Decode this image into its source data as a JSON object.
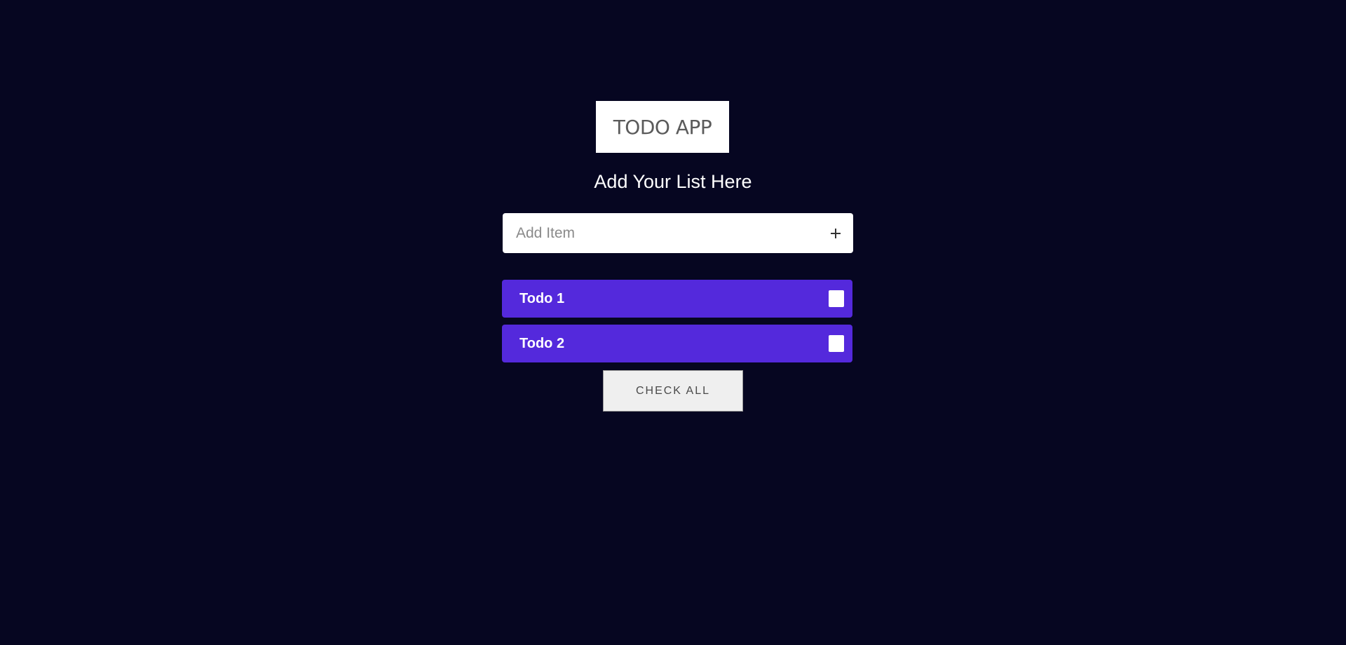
{
  "header": {
    "logo_text": "TODO APP",
    "subtitle": "Add Your List Here"
  },
  "add_item": {
    "placeholder": "Add Item",
    "value": "",
    "add_icon": "plus-icon"
  },
  "todos": [
    {
      "label": "Todo 1",
      "checked": false
    },
    {
      "label": "Todo 2",
      "checked": false
    }
  ],
  "actions": {
    "check_all_label": "CHECK ALL"
  },
  "colors": {
    "background": "#060621",
    "todo_item": "#5429dc",
    "logo_box": "#ffffff",
    "button_bg": "#efefef"
  }
}
